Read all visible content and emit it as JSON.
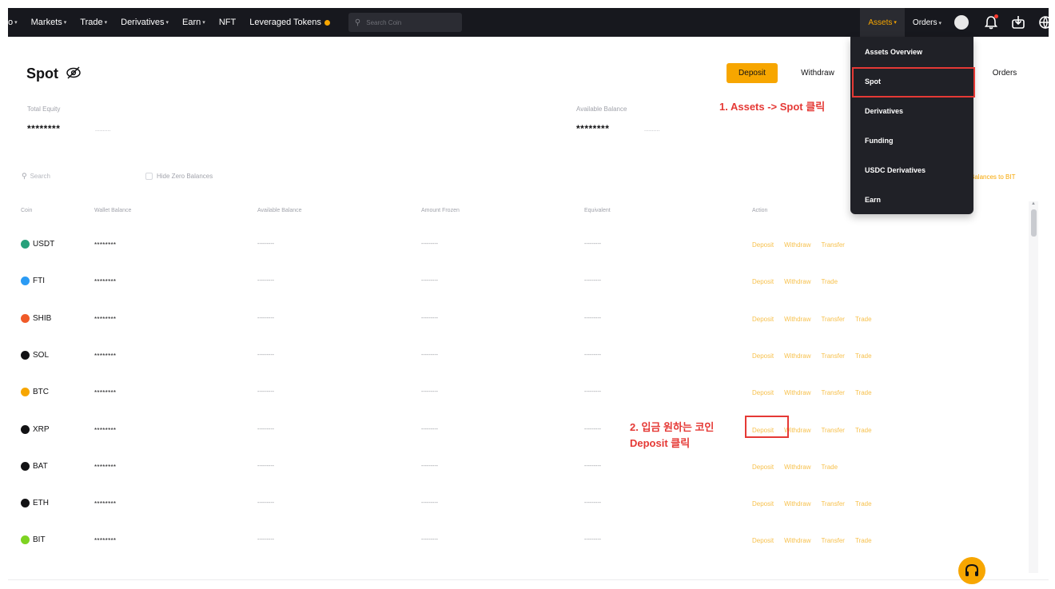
{
  "nav": {
    "items": [
      {
        "label": "o",
        "caret": "▾"
      },
      {
        "label": "Markets",
        "caret": "▾"
      },
      {
        "label": "Trade",
        "caret": "▾"
      },
      {
        "label": "Derivatives",
        "caret": "▾"
      },
      {
        "label": "Earn",
        "caret": "▾"
      },
      {
        "label": "NFT",
        "caret": ""
      },
      {
        "label": "Leveraged Tokens",
        "caret": ""
      }
    ],
    "search_placeholder": "Search Coin",
    "assets_label": "Assets",
    "orders_label": "Orders",
    "caret": "▾"
  },
  "page": {
    "title": "Spot",
    "deposit_label": "Deposit",
    "withdraw_label": "Withdraw",
    "orders_label": "Orders",
    "total_equity_label": "Total Equity",
    "total_equity_value": "********",
    "total_equity_unit": "..........",
    "available_balance_label": "Available Balance",
    "available_balance_value": "********",
    "available_balance_unit": "..........",
    "filter_search_placeholder": "Search",
    "hide_zero_label": "Hide Zero Balances",
    "convert_link": "Balances to BIT"
  },
  "table": {
    "headers": [
      "Coin",
      "Wallet Balance",
      "Available Balance",
      "Amount Frozen",
      "Equivalent",
      "Action"
    ],
    "rows": [
      {
        "coin": "USDT",
        "icon_color": "#26a17b",
        "wallet": "********",
        "available": "---------",
        "frozen": "---------",
        "equivalent": "---------",
        "actions": [
          "Deposit",
          "Withdraw",
          "Transfer"
        ]
      },
      {
        "coin": "FTI",
        "icon_color": "#2b9bf4",
        "wallet": "********",
        "available": "---------",
        "frozen": "---------",
        "equivalent": "---------",
        "actions": [
          "Deposit",
          "Withdraw",
          "Trade"
        ]
      },
      {
        "coin": "SHIB",
        "icon_color": "#f05a28",
        "wallet": "********",
        "available": "---------",
        "frozen": "---------",
        "equivalent": "---------",
        "actions": [
          "Deposit",
          "Withdraw",
          "Transfer",
          "Trade"
        ]
      },
      {
        "coin": "SOL",
        "icon_color": "#121214",
        "wallet": "********",
        "available": "---------",
        "frozen": "---------",
        "equivalent": "---------",
        "actions": [
          "Deposit",
          "Withdraw",
          "Transfer",
          "Trade"
        ]
      },
      {
        "coin": "BTC",
        "icon_color": "#f7a600",
        "wallet": "********",
        "available": "---------",
        "frozen": "---------",
        "equivalent": "---------",
        "actions": [
          "Deposit",
          "Withdraw",
          "Transfer",
          "Trade"
        ]
      },
      {
        "coin": "XRP",
        "icon_color": "#121214",
        "wallet": "********",
        "available": "---------",
        "frozen": "---------",
        "equivalent": "---------",
        "actions": [
          "Deposit",
          "Withdraw",
          "Transfer",
          "Trade"
        ]
      },
      {
        "coin": "BAT",
        "icon_color": "#121214",
        "wallet": "********",
        "available": "---------",
        "frozen": "---------",
        "equivalent": "---------",
        "actions": [
          "Deposit",
          "Withdraw",
          "Trade"
        ]
      },
      {
        "coin": "ETH",
        "icon_color": "#121214",
        "wallet": "********",
        "available": "---------",
        "frozen": "---------",
        "equivalent": "---------",
        "actions": [
          "Deposit",
          "Withdraw",
          "Transfer",
          "Trade"
        ]
      },
      {
        "coin": "BIT",
        "icon_color": "#7ed321",
        "wallet": "********",
        "available": "---------",
        "frozen": "---------",
        "equivalent": "---------",
        "actions": [
          "Deposit",
          "Withdraw",
          "Transfer",
          "Trade"
        ]
      }
    ]
  },
  "dropdown": {
    "items": [
      "Assets Overview",
      "Spot",
      "Derivatives",
      "Funding",
      "USDC Derivatives",
      "Earn"
    ]
  },
  "annotations": {
    "step1": "1. Assets -> Spot 클릭",
    "step2_line1": "2. 입금 원하는 코인",
    "step2_line2": "Deposit 클릭"
  },
  "colors": {
    "accent": "#f7a600",
    "annotation": "#e53935",
    "nav_bg": "#17181e"
  }
}
